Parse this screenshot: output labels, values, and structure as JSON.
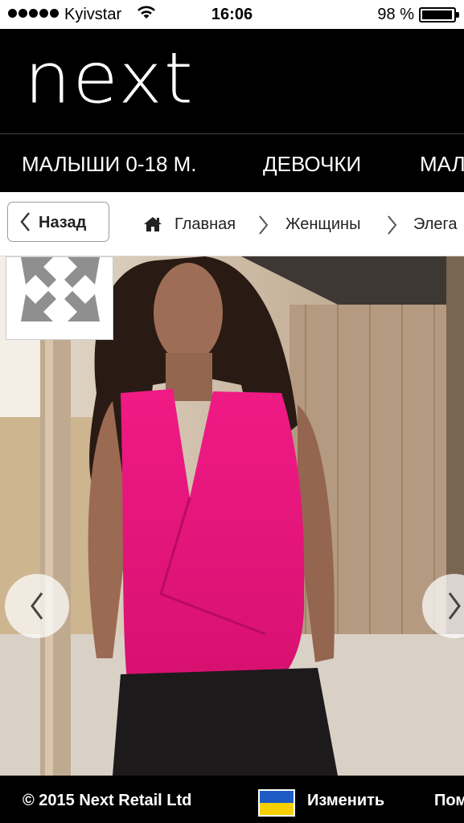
{
  "status_bar": {
    "carrier": "Kyivstar",
    "time": "16:06",
    "battery": "98 %"
  },
  "header": {
    "logo": "next"
  },
  "nav": {
    "items": [
      "МАЛЫШИ 0-18 М.",
      "ДЕВОЧКИ",
      "МАЛ"
    ]
  },
  "breadcrumb": {
    "back_label": "Назад",
    "items": [
      "Главная",
      "Женщины",
      "Элега"
    ]
  },
  "footer": {
    "copyright": "© 2015 Next Retail Ltd",
    "change_label": "Изменить",
    "help_label": "Пом"
  },
  "colors": {
    "brand": "#000000",
    "product_top": "#e8167d",
    "flag_blue": "#1f5bc4",
    "flag_yellow": "#f6d000"
  },
  "icons": [
    "wifi-icon",
    "battery-icon",
    "home-icon",
    "chevron-left-icon",
    "chevron-right-icon",
    "expand-icon"
  ]
}
